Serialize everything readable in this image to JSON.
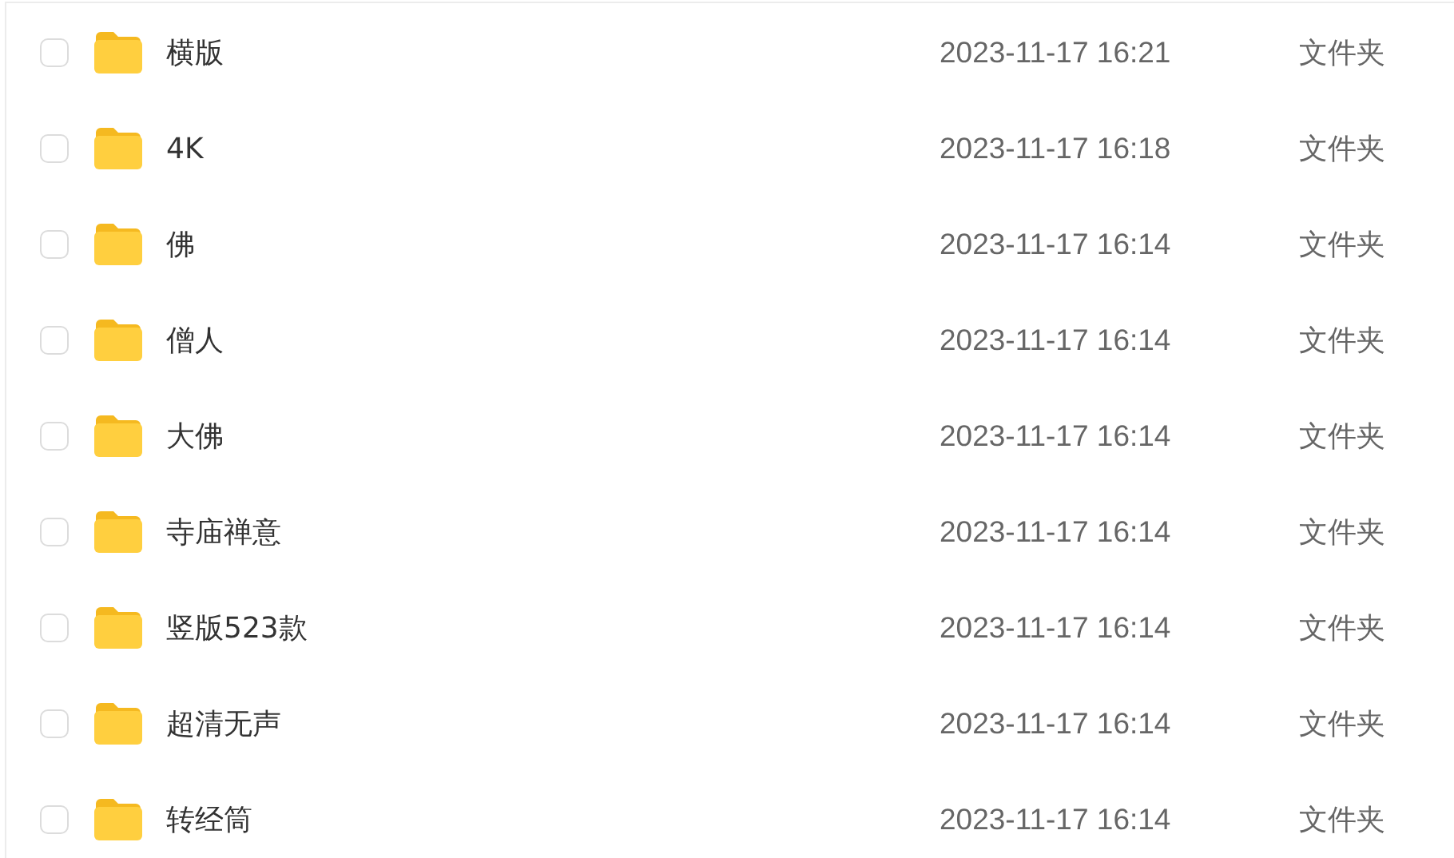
{
  "files": [
    {
      "name": "横版",
      "modified": "2023-11-17 16:21",
      "type": "文件夹",
      "checked": false
    },
    {
      "name": "4K",
      "modified": "2023-11-17 16:18",
      "type": "文件夹",
      "checked": false
    },
    {
      "name": "佛",
      "modified": "2023-11-17 16:14",
      "type": "文件夹",
      "checked": false
    },
    {
      "name": "僧人",
      "modified": "2023-11-17 16:14",
      "type": "文件夹",
      "checked": false
    },
    {
      "name": "大佛",
      "modified": "2023-11-17 16:14",
      "type": "文件夹",
      "checked": false
    },
    {
      "name": "寺庙禅意",
      "modified": "2023-11-17 16:14",
      "type": "文件夹",
      "checked": false
    },
    {
      "name": "竖版523款",
      "modified": "2023-11-17 16:14",
      "type": "文件夹",
      "checked": false
    },
    {
      "name": "超清无声",
      "modified": "2023-11-17 16:14",
      "type": "文件夹",
      "checked": false
    },
    {
      "name": "转经筒",
      "modified": "2023-11-17 16:14",
      "type": "文件夹",
      "checked": false
    }
  ]
}
